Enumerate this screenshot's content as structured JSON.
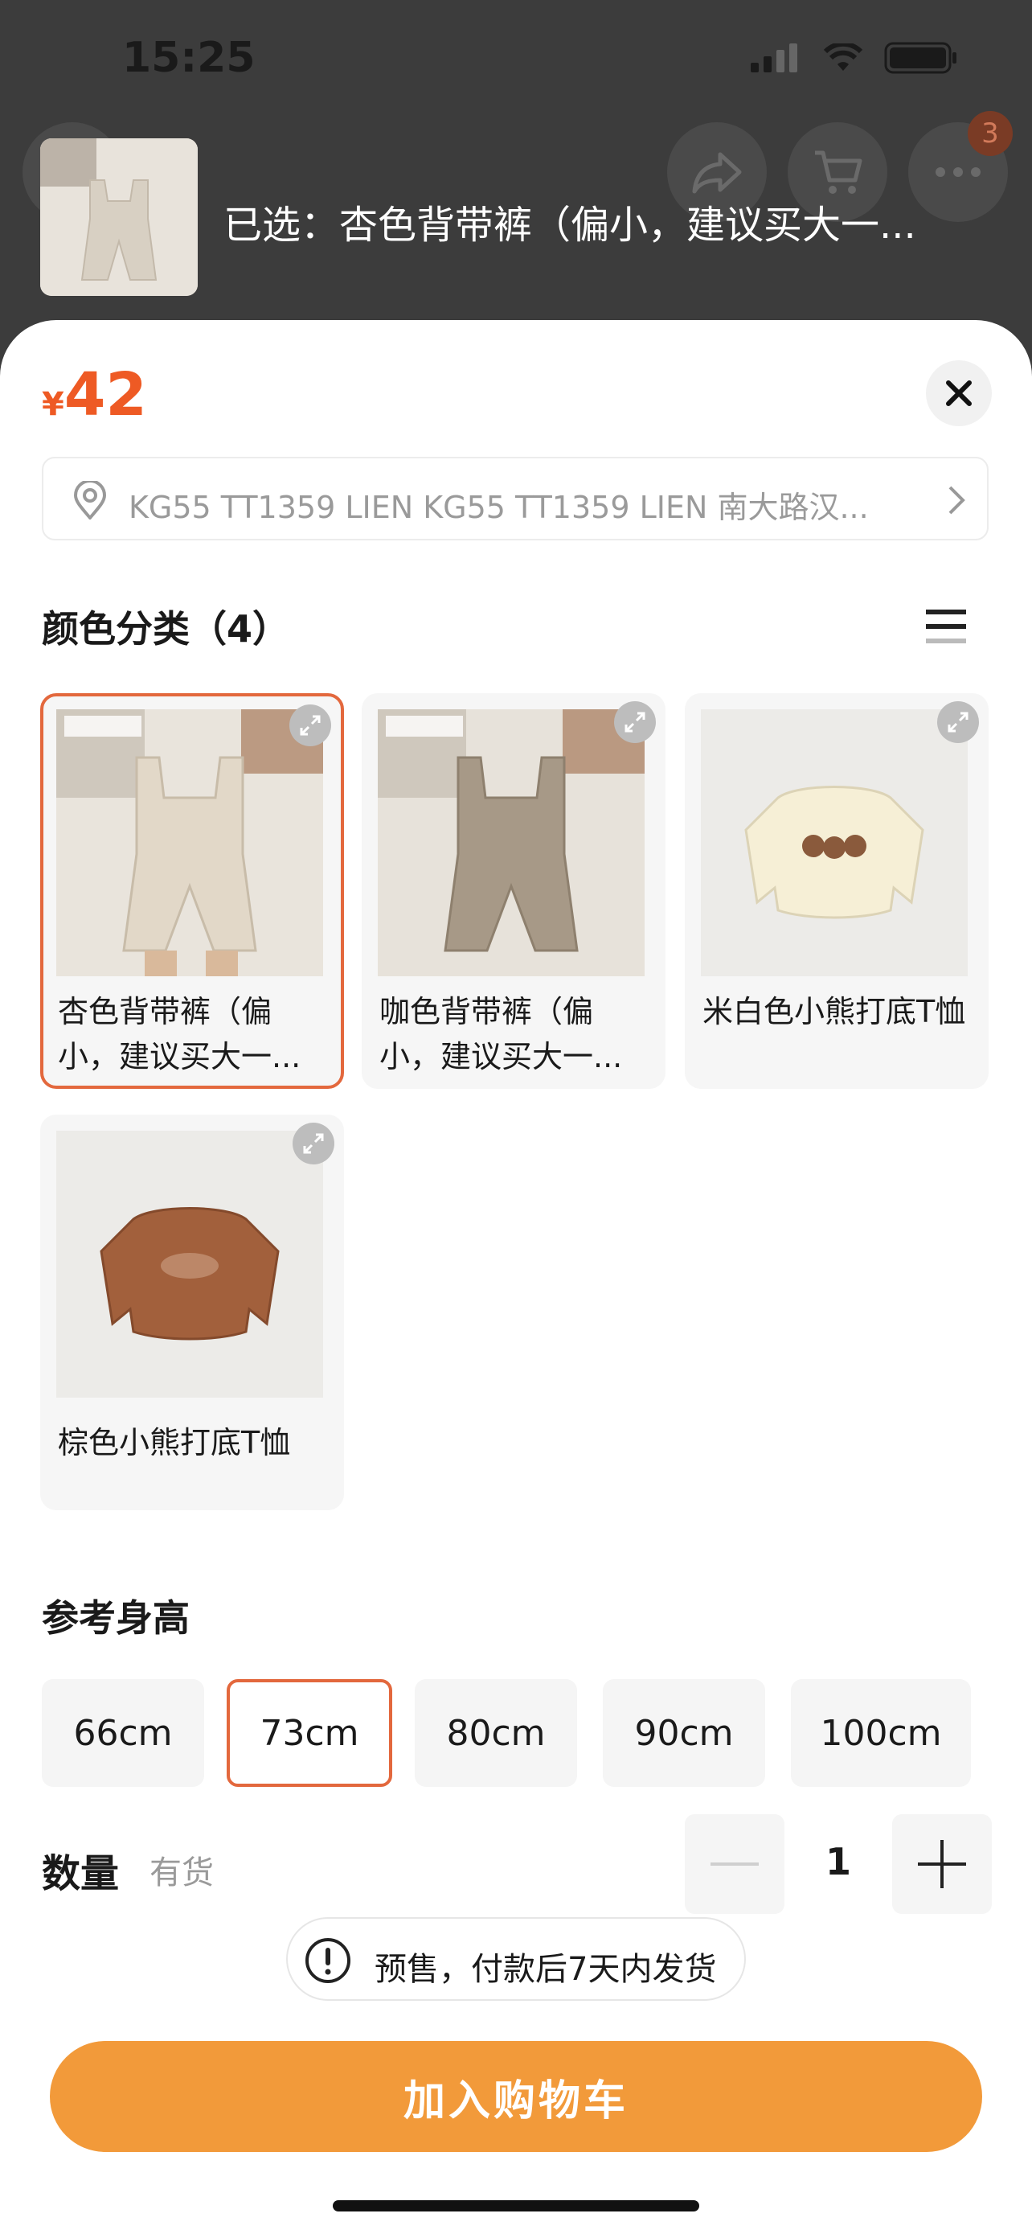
{
  "status_bar": {
    "time": "15:25"
  },
  "background": {
    "cart_badge_count": "3",
    "selected_prefix": "已选：",
    "selected_name": "杏色背带裤（偏小，建议买大一..."
  },
  "sheet": {
    "currency": "¥",
    "price": "42",
    "address": "KG55 TT1359 LIEN KG55 TT1359 LIEN 南大路汉...",
    "color_section": {
      "title": "颜色分类（4）"
    },
    "options": [
      {
        "label": "杏色背带裤（偏小，建议买大一...",
        "selected": true
      },
      {
        "label": "咖色背带裤（偏小，建议买大一...",
        "selected": false
      },
      {
        "label": "米白色小熊打底T恤",
        "selected": false
      },
      {
        "label": "棕色小熊打底T恤",
        "selected": false
      }
    ],
    "size_section": {
      "title": "参考身高"
    },
    "sizes": [
      {
        "label": "66cm",
        "selected": false
      },
      {
        "label": "73cm",
        "selected": true
      },
      {
        "label": "80cm",
        "selected": false
      },
      {
        "label": "90cm",
        "selected": false
      },
      {
        "label": "100cm",
        "selected": false
      }
    ],
    "quantity": {
      "label": "数量",
      "stock": "有货",
      "value": "1"
    },
    "notice": "预售，付款后7天内发货",
    "add_to_cart": "加入购物车"
  },
  "colors": {
    "accent": "#EE5A24",
    "selected_border": "#E3683D",
    "cart_button": "#F29A3A"
  },
  "icons": [
    "share-icon",
    "cart-icon",
    "more-icon",
    "close-icon",
    "location-pin-icon",
    "chevron-right-icon",
    "list-view-icon",
    "expand-icon",
    "minus-icon",
    "plus-icon",
    "info-icon"
  ]
}
